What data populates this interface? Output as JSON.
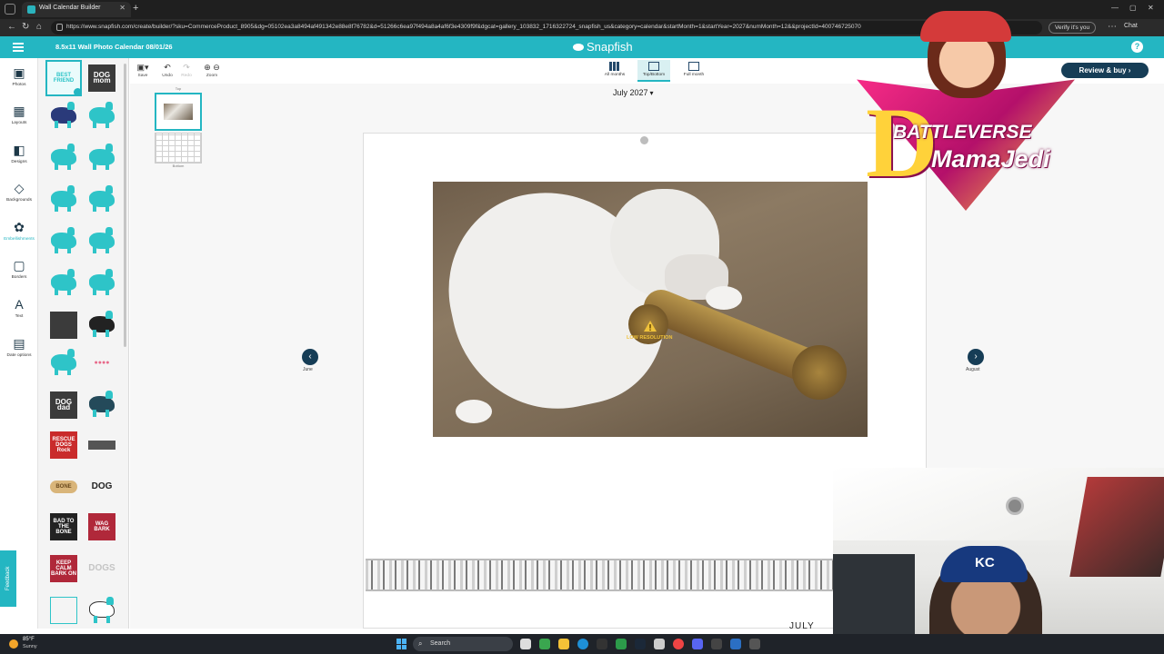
{
  "browser": {
    "tab_title": "Wall Calendar Builder",
    "url": "https://www.snapfish.com/create/builder/?sku=CommerceProduct_8905&dg=05102ea3a8494af491342e88e8f76782&d=51266c6ea97f494a8a4af6f3e4309f9f&dgcat=gallery_103832_1716322724_snapfish_us&category=calendar&startMonth=1&startYear=2027&numMonth=12&&projectId=400746725070",
    "verify_label": "Verify it's you",
    "chat_label": "Chat"
  },
  "app": {
    "project_title": "8.5x11 Wall Photo Calendar 08/01/26",
    "brand": "Snapfish",
    "help_label": "?"
  },
  "rail": [
    {
      "label": "Photos",
      "icon": "photos-icon",
      "glyph": "▣"
    },
    {
      "label": "Layouts",
      "icon": "layouts-icon",
      "glyph": "▦"
    },
    {
      "label": "Designs",
      "icon": "designs-icon",
      "glyph": "◧"
    },
    {
      "label": "Backgrounds",
      "icon": "backgrounds-icon",
      "glyph": "◇"
    },
    {
      "label": "Embellishments",
      "icon": "embellishments-icon",
      "glyph": "✿"
    },
    {
      "label": "Borders",
      "icon": "borders-icon",
      "glyph": "▢"
    },
    {
      "label": "Text",
      "icon": "text-icon",
      "glyph": "A"
    },
    {
      "label": "Date options",
      "icon": "date-options-icon",
      "glyph": "▤"
    }
  ],
  "embellishments": {
    "sticker_texts": {
      "best_friend": "BEST FRIEND",
      "dog_mom": "DOG mom",
      "dog_dad": "DOG dad",
      "rescue": "RESCUE DOGS Rock",
      "bad_bone": "BAD TO THE BONE",
      "wag_bark": "WAG BARK",
      "keep_calm": "KEEP CALM BARK ON",
      "dogs": "DOGS",
      "dog": "DOG",
      "bone": "BONE"
    }
  },
  "toolbar": {
    "save": "Save",
    "undo": "Undo",
    "redo": "Redo",
    "zoom": "Zoom",
    "views": {
      "all_months": "All months",
      "top_bottom": "Top/Bottom",
      "full_month": "Full month"
    },
    "review_buy": "Review & buy ›"
  },
  "pages": {
    "top_label": "Top",
    "bottom_label": "Bottom"
  },
  "calendar": {
    "current_month": "July 2027",
    "prev_month": "June",
    "next_month": "August",
    "warning_text": "LOW RESOLUTION",
    "peek_text": "JULY"
  },
  "overlay": {
    "logo_line1": "BATTLEVERSE",
    "logo_line2": "MamaJedi",
    "cap_text": "KC"
  },
  "feedback_label": "Feedback",
  "taskbar": {
    "temperature": "85°F",
    "condition": "Sunny",
    "search": "Search"
  },
  "colors": {
    "accent": "#24b6c2",
    "navy": "#163d56",
    "warning": "#f0c23a"
  }
}
